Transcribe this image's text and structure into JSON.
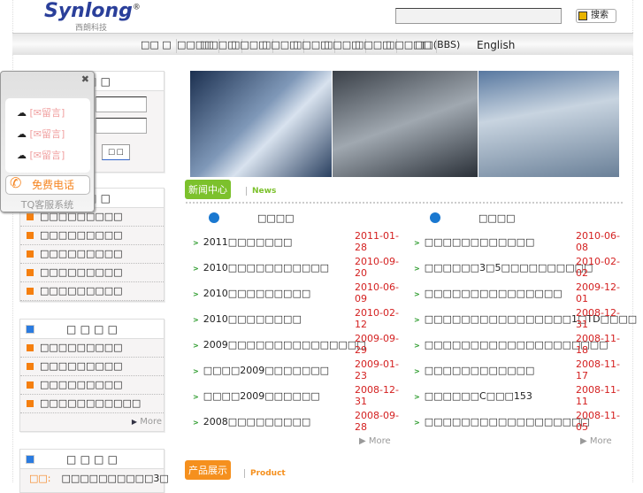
{
  "header": {
    "logo": "Synlong",
    "logo_sub": "西朗科技",
    "search_value": "",
    "search_button": "搜索"
  },
  "nav": [
    "□□ □",
    "□□□□",
    "□□□□",
    "□□□□",
    "□□□□",
    "□□□□",
    "□□□□",
    "□□□□",
    "□□□□□",
    "□□(BBS)",
    "English"
  ],
  "tq": {
    "rows": [
      "[✉留言]",
      "[✉留言]",
      "[✉留言]"
    ],
    "call": "免费电话",
    "system": "TQ客服系统"
  },
  "login": {
    "title": "□ □ □",
    "button": "□ □"
  },
  "box2": {
    "title": "□ □",
    "items": [
      "□□□□□□□□□",
      "□□□□□□□□□",
      "□□□□□□□□□",
      "□□□□□□□□□",
      "□□□□□□□□□"
    ]
  },
  "box3": {
    "title": "□ □ □ □",
    "items": [
      "□□□□□□□□□",
      "□□□□□□□□□",
      "□□□□□□□□□",
      "□□□□□□□□□□□"
    ],
    "more": "More"
  },
  "box4": {
    "title": "□ □ □ □",
    "label": "□□:",
    "item": "□□□□□□□□□□3□"
  },
  "news_section": {
    "tag": "新闻中心",
    "en": "News"
  },
  "product_section": {
    "tag": "产品展示",
    "en": "Product"
  },
  "news_left": {
    "title": "□□□□",
    "more": "More",
    "items": [
      {
        "t": "2011□□□□□□□",
        "d": "2011-01-28"
      },
      {
        "t": "2010□□□□□□□□□□□",
        "d": "2010-09-20"
      },
      {
        "t": "2010□□□□□□□□□",
        "d": "2010-06-09"
      },
      {
        "t": "2010□□□□□□□□",
        "d": "2010-02-12"
      },
      {
        "t": "2009□□□□□□□□□□□□□□□",
        "d": "2009-09-29"
      },
      {
        "t": "□□□□2009□□□□□□□",
        "d": "2009-01-23"
      },
      {
        "t": "□□□□2009□□□□□□",
        "d": "2008-12-31"
      },
      {
        "t": "2008□□□□□□□□□",
        "d": "2008-09-28"
      }
    ]
  },
  "news_right": {
    "title": "□□□□",
    "more": "More",
    "items": [
      {
        "t": "□□□□□□□□□□□□",
        "d": "2010-06-08"
      },
      {
        "t": "□□□□□□3□5□□□□□□□□□□",
        "d": "2010-02-02"
      },
      {
        "t": "□□□□□□□□□□□□□□□",
        "d": "2009-12-01"
      },
      {
        "t": "□□□□□□□□□□□□□□□□1□TD□□□□",
        "d": "2008-12-31"
      },
      {
        "t": "□□□□□□□□□□□□□□□□□□□□",
        "d": "2008-11-18"
      },
      {
        "t": "□□□□□□□□□□□□",
        "d": "2008-11-17"
      },
      {
        "t": "□□□□□□C□□□153",
        "d": "2008-11-11"
      },
      {
        "t": "□□□□□□□□□□□□□□□□□□",
        "d": "2008-11-05"
      }
    ]
  }
}
